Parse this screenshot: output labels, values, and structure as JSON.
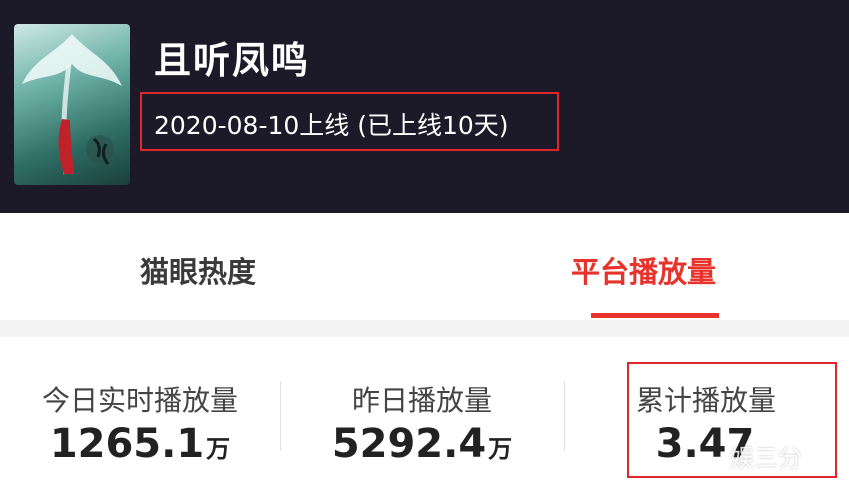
{
  "drama": {
    "title": "且听凤鸣",
    "release_info": "2020-08-10上线 (已上线10天)"
  },
  "tabs": [
    {
      "label": "猫眼热度",
      "active": false
    },
    {
      "label": "平台播放量",
      "active": true
    }
  ],
  "stats": [
    {
      "label": "今日实时播放量",
      "value": "1265.1",
      "unit": "万"
    },
    {
      "label": "昨日播放量",
      "value": "5292.4",
      "unit": "万"
    },
    {
      "label": "累计播放量",
      "value": "3.47",
      "unit": ""
    }
  ],
  "watermark": "娱三分",
  "colors": {
    "header_bg": "#1c1a29",
    "accent": "#e8332c",
    "highlight_box": "#e0262b"
  }
}
